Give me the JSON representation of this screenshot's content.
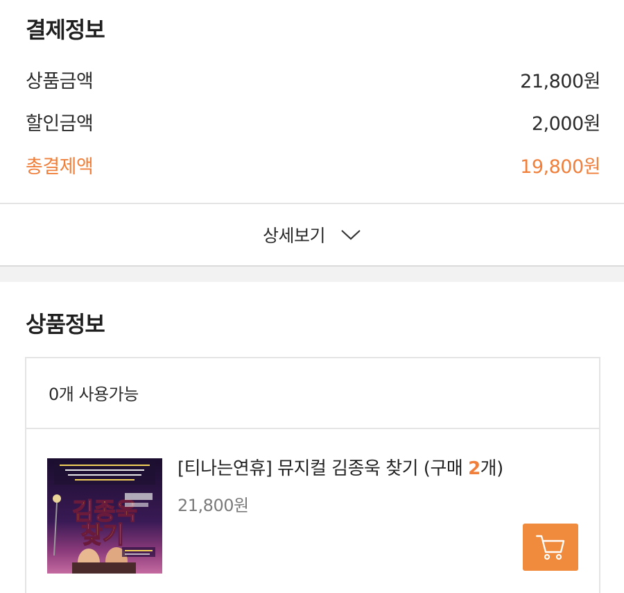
{
  "payment": {
    "title": "결제정보",
    "rows": [
      {
        "label": "상품금액",
        "value": "21,800원"
      },
      {
        "label": "할인금액",
        "value": "2,000원"
      },
      {
        "label": "총결제액",
        "value": "19,800원"
      }
    ],
    "detail_toggle_label": "상세보기"
  },
  "product_section": {
    "title": "상품정보",
    "available_text": "0개 사용가능",
    "item": {
      "name_prefix": "[티나는연휴] 뮤지컬 김종욱 찾기 (구매 ",
      "quantity": "2",
      "name_suffix": "개)",
      "price": "21,800원",
      "poster_title_line1": "김종욱",
      "poster_title_line2": "찾기"
    }
  },
  "colors": {
    "accent": "#ef7f3a",
    "cart_button": "#f08a3c",
    "divider": "#e4e4e4",
    "band": "#f2f2f2"
  },
  "icons": {
    "detail_toggle": "chevron-down-icon",
    "cart": "shopping-cart-icon"
  }
}
